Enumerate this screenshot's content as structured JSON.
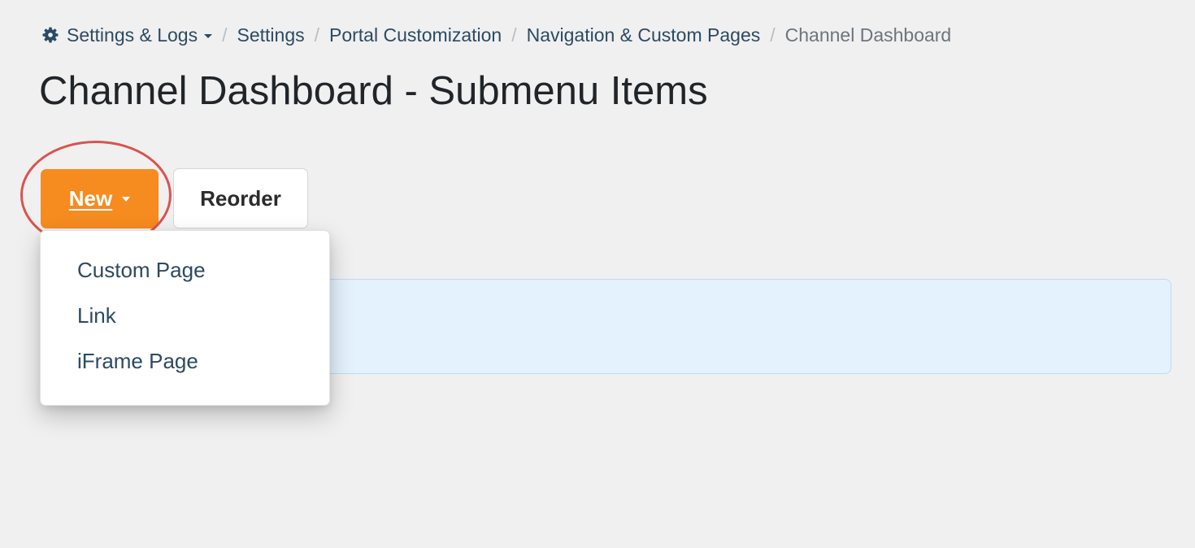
{
  "breadcrumb": {
    "items": [
      {
        "label": "Settings & Logs",
        "icon": "gear-icon"
      },
      {
        "label": "Settings"
      },
      {
        "label": "Portal Customization"
      },
      {
        "label": "Navigation & Custom Pages"
      },
      {
        "label": "Channel Dashboard"
      }
    ],
    "separator": "/"
  },
  "page": {
    "title": "Channel Dashboard - Submenu Items"
  },
  "toolbar": {
    "new_label": "New",
    "reorder_label": "Reorder"
  },
  "new_menu": {
    "items": [
      {
        "label": "Custom Page"
      },
      {
        "label": "Link"
      },
      {
        "label": "iFrame Page"
      }
    ]
  },
  "colors": {
    "primary_button": "#f68b1f",
    "link": "#2c4a63",
    "highlight": "#d9544f",
    "info_panel": "#e4f2fd"
  }
}
